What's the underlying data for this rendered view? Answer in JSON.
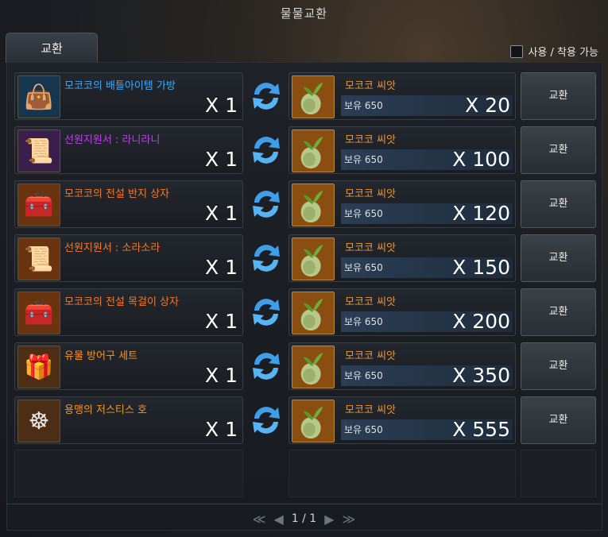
{
  "window": {
    "title": "물물교환"
  },
  "tab": {
    "label": "교환"
  },
  "filter": {
    "label": "사용 / 착용 가능",
    "checked": false
  },
  "seed": {
    "name": "모코코 씨앗",
    "owned_label": "보유 650"
  },
  "exchange_label": "교환",
  "rows": [
    {
      "name": "모코코의 배틀아이템 가방",
      "color": "#3fa9f5",
      "qty": "X 1",
      "cost": "X 20",
      "icon": "bag-icon",
      "glyph": "👜",
      "bg": "blue"
    },
    {
      "name": "선원지원서 : 라니라니",
      "color": "#c040e8",
      "qty": "X 1",
      "cost": "X 100",
      "icon": "scroll-icon",
      "glyph": "📜",
      "bg": "purple"
    },
    {
      "name": "모코코의 전설 반지 상자",
      "color": "#f27a2a",
      "qty": "X 1",
      "cost": "X 120",
      "icon": "chest-icon",
      "glyph": "🧰",
      "bg": "orange"
    },
    {
      "name": "선원지원서 : 소라소라",
      "color": "#f27a2a",
      "qty": "X 1",
      "cost": "X 150",
      "icon": "scroll-icon",
      "glyph": "📜",
      "bg": "orange"
    },
    {
      "name": "모코코의 전설 목걸이 상자",
      "color": "#f27a2a",
      "qty": "X 1",
      "cost": "X 200",
      "icon": "chest-icon",
      "glyph": "🧰",
      "bg": "orange"
    },
    {
      "name": "유물 방어구 세트",
      "color": "#f2952a",
      "qty": "X 1",
      "cost": "X 350",
      "icon": "treasure-chest-icon",
      "glyph": "🎁",
      "bg": "brown"
    },
    {
      "name": "용맹의 저스티스 호",
      "color": "#f2952a",
      "qty": "X 1",
      "cost": "X 555",
      "icon": "ship-wheel-icon",
      "glyph": "☸",
      "bg": "brown"
    }
  ],
  "pager": {
    "first": "≪",
    "prev": "◀",
    "page": "1 / 1",
    "next": "▶",
    "last": "≫"
  }
}
